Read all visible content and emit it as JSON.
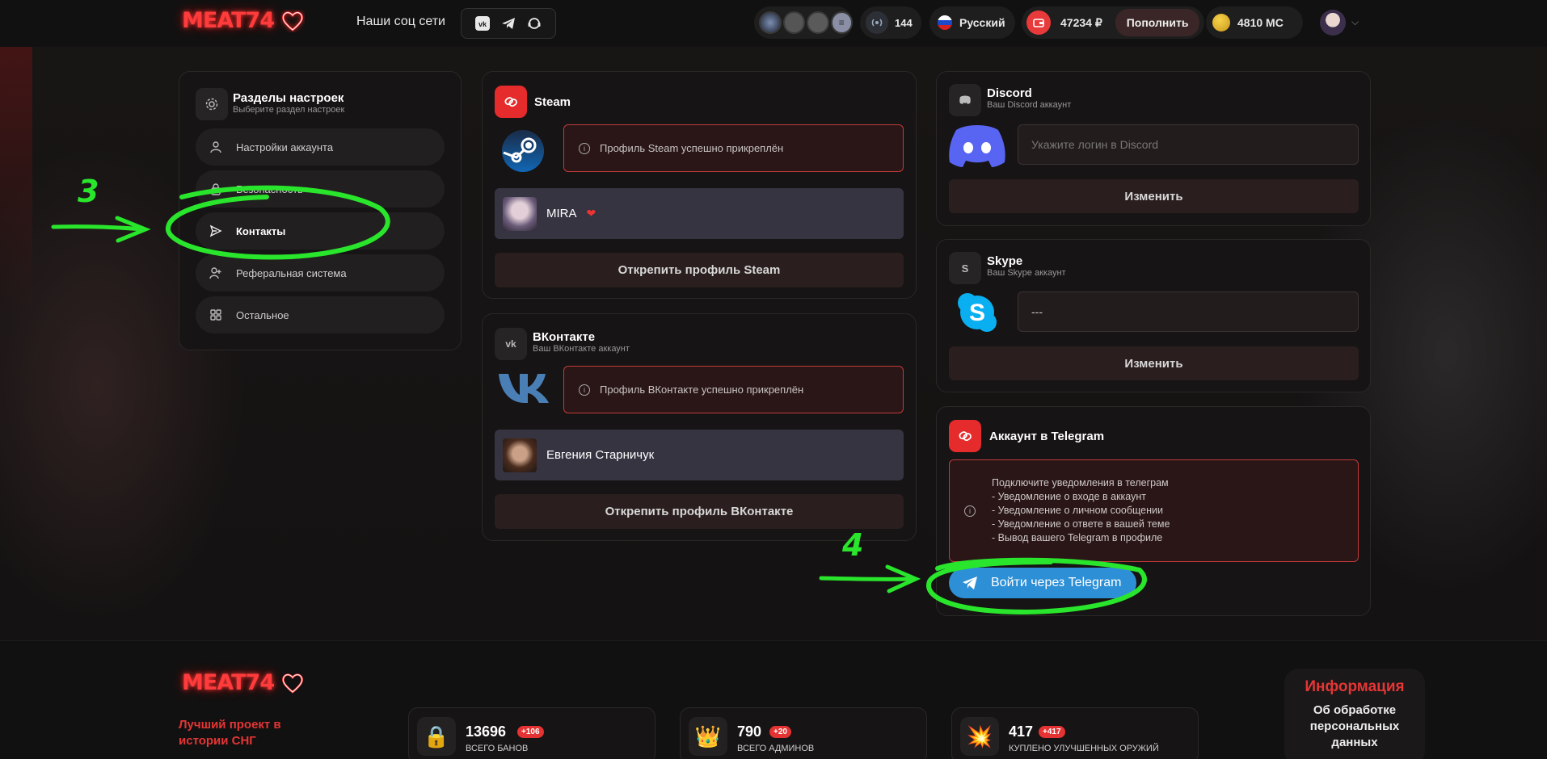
{
  "header": {
    "logo": "MEAT74",
    "social_label": "Наши соц сети",
    "online_count": "144",
    "language": "Русский",
    "balance": "47234 ₽",
    "topup": "Пополнить",
    "mc": "4810 MC"
  },
  "sidebar": {
    "title": "Разделы настроек",
    "subtitle": "Выберите раздел настроек",
    "items": [
      {
        "label": "Настройки аккаунта",
        "icon": "user-icon"
      },
      {
        "label": "Безопасность",
        "icon": "lock-icon"
      },
      {
        "label": "Контакты",
        "icon": "send-icon"
      },
      {
        "label": "Реферальная система",
        "icon": "user-plus-icon"
      },
      {
        "label": "Остальное",
        "icon": "grid-icon"
      }
    ]
  },
  "steam": {
    "title": "Steam",
    "alert": "Профиль Steam успешно прикреплён",
    "user": "MIRA",
    "unlink": "Открепить профиль Steam"
  },
  "vk": {
    "title": "ВКонтакте",
    "subtitle": "Ваш ВКонтакте аккаунт",
    "alert": "Профиль ВКонтакте успешно прикреплён",
    "user": "Евгения Старничук",
    "unlink": "Открепить профиль ВКонтакте"
  },
  "discord": {
    "title": "Discord",
    "subtitle": "Ваш Discord аккаунт",
    "placeholder": "Укажите логин в Discord",
    "button": "Изменить"
  },
  "skype": {
    "title": "Skype",
    "subtitle": "Ваш Skype аккаунт",
    "value": "---",
    "button": "Изменить"
  },
  "telegram": {
    "title": "Аккаунт в Telegram",
    "lines": [
      "Подключите уведомления в телеграм",
      "- Уведомление о входе в аккаунт",
      "- Уведомление о личном сообщении",
      "- Уведомление о ответе в вашей теме",
      "- Вывод вашего Telegram в профиле"
    ],
    "login": "Войти через Telegram"
  },
  "annotations": {
    "step3": "3",
    "step4": "4"
  },
  "footer": {
    "logo": "MEAT74",
    "slogan_1": "Лучший проект в",
    "slogan_2": "истории СНГ",
    "stats": [
      {
        "value": "13696",
        "badge": "+106",
        "label": "всего банов",
        "icon": "lock-icon"
      },
      {
        "value": "790",
        "badge": "+20",
        "label": "всего админов",
        "icon": "crown-icon"
      },
      {
        "value": "417",
        "badge": "+417",
        "label": "куплено улучшенных оружий",
        "icon": "explosion-icon"
      }
    ],
    "info_title": "Информация",
    "info_line1": "Об обработке",
    "info_line2": "персональных",
    "info_line3": "данных"
  }
}
